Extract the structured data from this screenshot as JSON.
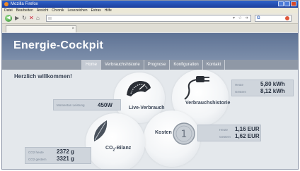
{
  "browser": {
    "title": "Mozilla Firefox",
    "menu": [
      "Datei",
      "Bearbeiten",
      "Ansicht",
      "Chronik",
      "Lesezeichen",
      "Extras",
      "Hilfe"
    ]
  },
  "app": {
    "title": "Energie-Cockpit",
    "nav": [
      "Home",
      "Verbrauchshistorie",
      "Prognose",
      "Konfiguration",
      "Kontakt"
    ],
    "active_nav": "Home",
    "welcome": "Herzlich willkommen!"
  },
  "circles": {
    "live": "Live-Verbrauch",
    "history": "Verbrauchshistorie",
    "costs": "Kosten",
    "co2": "CO",
    "co2_sub": "2",
    "co2_suffix": "-Bilanz"
  },
  "live_panel": {
    "label": "Momentan Leistung",
    "value": "450W"
  },
  "usage_panel": {
    "today_label": "Heute",
    "today_value": "5,80 kWh",
    "yesterday_label": "Gestern",
    "yesterday_value": "8,12 kWh"
  },
  "cost_panel": {
    "today_label": "Heute",
    "today_value": "1,16 EUR",
    "yesterday_label": "Gestern",
    "yesterday_value": "1,62 EUR"
  },
  "co2_panel": {
    "today_label": "CO2 heute",
    "today_value": "2372 g",
    "yesterday_label": "CO2 gestern",
    "yesterday_value": "3321 g"
  },
  "colors": {
    "header": "#6e819f",
    "nav": "#8f98a6",
    "content": "#e4e8ec",
    "panel": "#cfd5dc"
  }
}
